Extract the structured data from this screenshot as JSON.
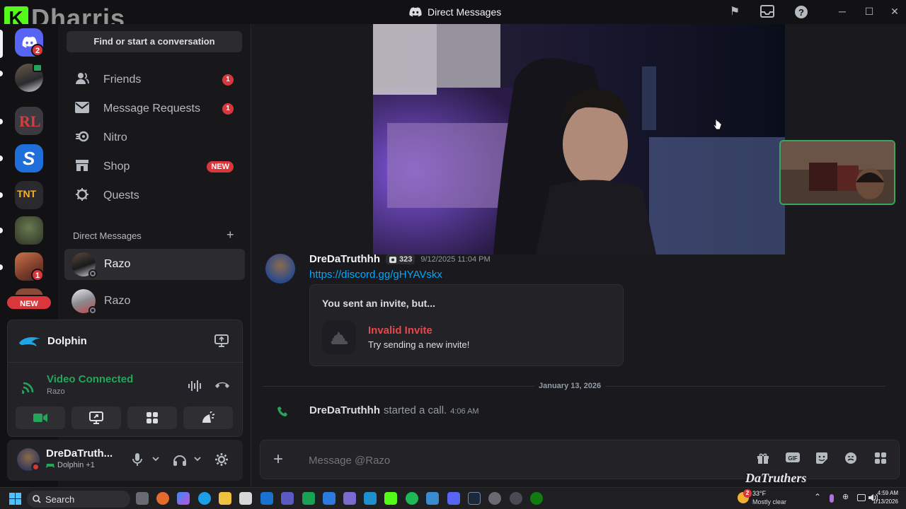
{
  "window": {
    "title": "Direct Messages",
    "overlay_watermark": "Dharris"
  },
  "rail": {
    "dm_badge": "2",
    "server_badge": "1",
    "new_label": "NEW"
  },
  "sidebar": {
    "search_placeholder": "Find or start a conversation",
    "nav": [
      {
        "label": "Friends",
        "badge": "1"
      },
      {
        "label": "Message Requests",
        "badge": "1"
      },
      {
        "label": "Nitro"
      },
      {
        "label": "Shop",
        "tag": "NEW"
      },
      {
        "label": "Quests"
      }
    ],
    "dm_header": "Direct Messages",
    "dms": [
      {
        "name": "Razo"
      },
      {
        "name": "Razo"
      }
    ]
  },
  "activity": {
    "game": "Dolphin"
  },
  "voice": {
    "status": "Video Connected",
    "channel": "Razo"
  },
  "user": {
    "name": "DreDaTruth...",
    "activity": "Dolphin +1"
  },
  "chat": {
    "message": {
      "author": "DreDaTruthhh",
      "tag_count": "323",
      "timestamp": "9/12/2025 11:04 PM",
      "link": "https://discord.gg/gHYAVskx"
    },
    "invite": {
      "heading": "You sent an invite, but...",
      "title": "Invalid Invite",
      "subtitle": "Try sending a new invite!"
    },
    "date_divider": "January 13, 2026",
    "call": {
      "author": "DreDaTruthhh",
      "text": "started a call.",
      "time": "4:06 AM"
    },
    "composer_placeholder": "Message @Razo"
  },
  "stream_overlay": "DaTruthers",
  "taskbar": {
    "search_label": "Search",
    "weather_temp": "33°F",
    "weather_desc": "Mostly clear",
    "weather_badge": "2",
    "time": "4:59 AM",
    "date": "1/13/2026"
  },
  "colors": {
    "accent_green": "#23a55a",
    "danger_red": "#da373c",
    "link_blue": "#00a8fc",
    "blurple": "#5865f2"
  }
}
